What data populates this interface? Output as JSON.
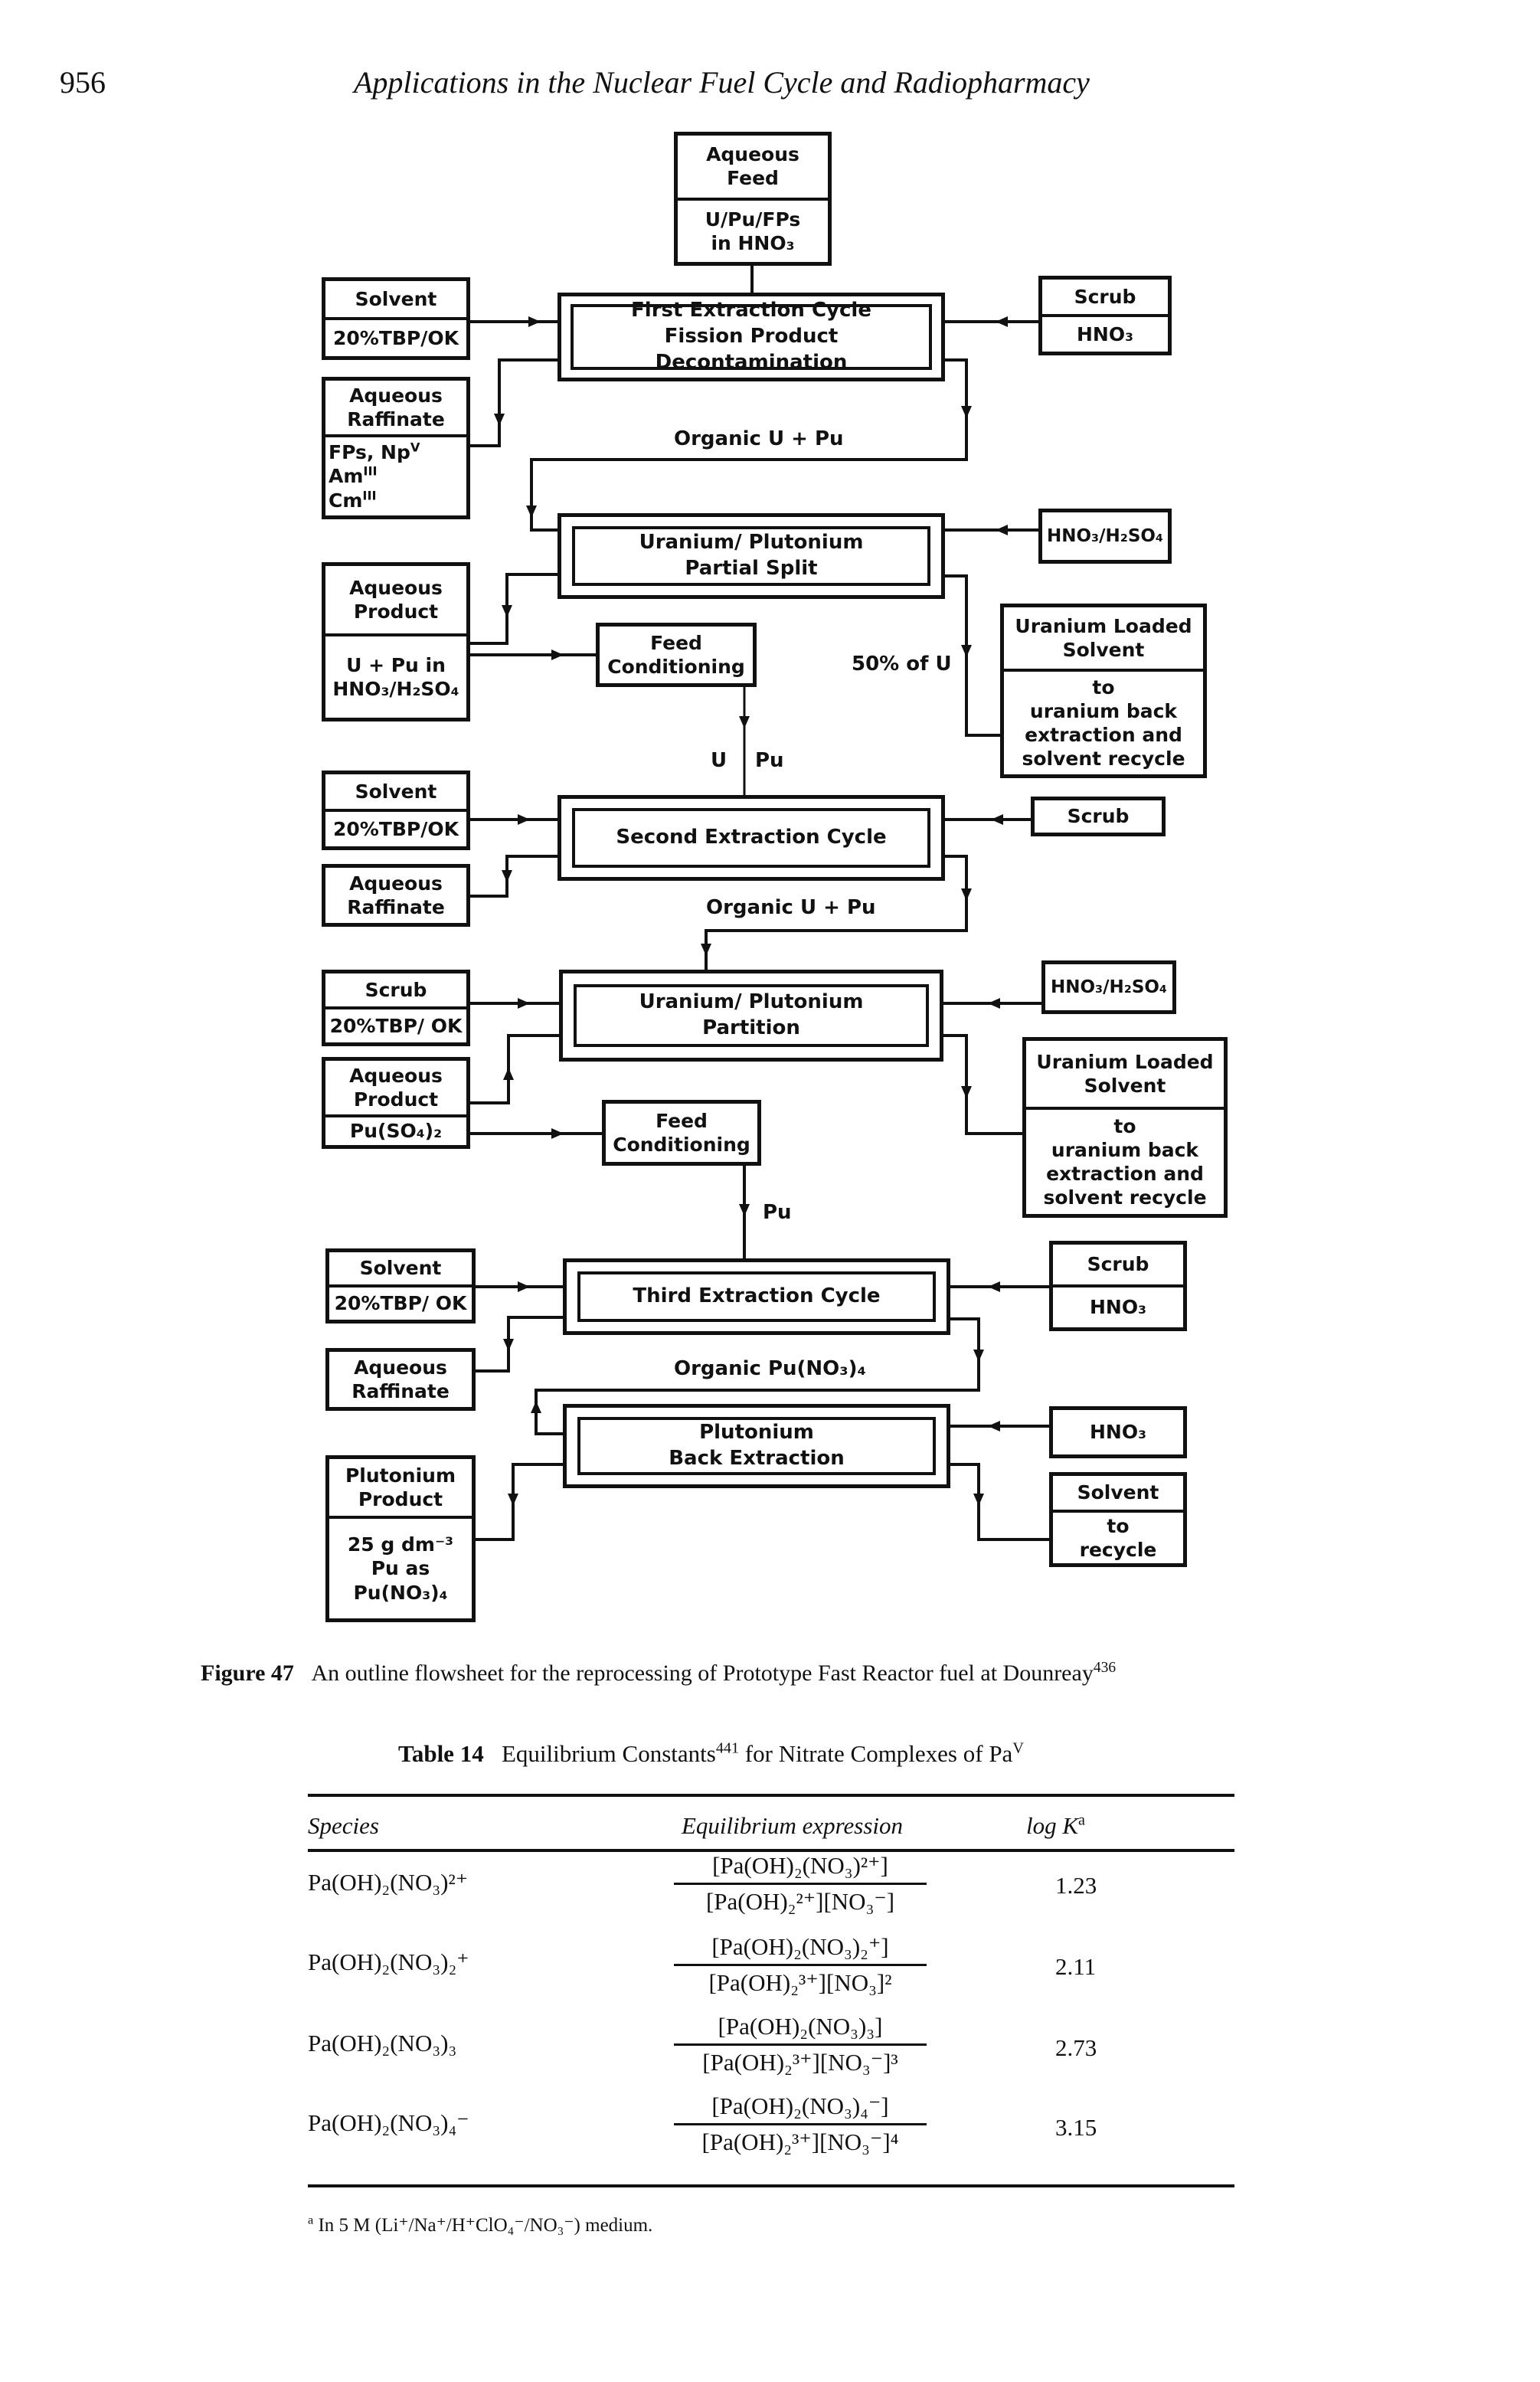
{
  "header": {
    "page_number": "956",
    "running_title": "Applications in the Nuclear Fuel Cycle and Radiopharmacy"
  },
  "flowsheet": {
    "aqueous_feed": {
      "title": [
        "Aqueous",
        "Feed"
      ],
      "content": [
        "U/Pu/FPs",
        "in HNO₃"
      ]
    },
    "cycle1": {
      "process": [
        "First Extraction Cycle",
        "Fission Product Decontamination"
      ],
      "solvent": {
        "title": "Solvent",
        "content": "20%TBP/OK"
      },
      "scrub": {
        "title": "Scrub",
        "content": "HNO₃"
      },
      "raffinate": {
        "title": [
          "Aqueous",
          "Raffinate"
        ],
        "content": [
          "FPs, Np",
          "Am",
          "Cm"
        ],
        "superscripts": [
          "V",
          "III",
          "III"
        ]
      },
      "organic_label": "Organic U + Pu"
    },
    "split": {
      "process": [
        "Uranium/ Plutonium",
        "Partial Split"
      ],
      "reagent": "HNO₃/H₂SO₄",
      "product": {
        "title": [
          "Aqueous",
          "Product"
        ],
        "content": [
          "U + Pu in",
          "HNO₃/H₂SO₄"
        ]
      },
      "feed_conditioning": [
        "Feed",
        "Conditioning"
      ],
      "fraction_label": "50% of U",
      "uranium_solvent": {
        "title": [
          "Uranium Loaded",
          "Solvent"
        ],
        "content": [
          "to",
          "uranium back",
          "extraction and",
          "solvent recycle"
        ]
      },
      "stream_left": "U",
      "stream_right": "Pu"
    },
    "cycle2": {
      "process": [
        "Second Extraction Cycle"
      ],
      "solvent": {
        "title": "Solvent",
        "content": "20%TBP/OK"
      },
      "scrub": {
        "title": "Scrub"
      },
      "raffinate": {
        "title": [
          "Aqueous",
          "Raffinate"
        ]
      },
      "organic_label": "Organic U + Pu"
    },
    "partition": {
      "process": [
        "Uranium/ Plutonium",
        "Partition"
      ],
      "scrub": {
        "title": "Scrub",
        "content": "20%TBP/ OK"
      },
      "reagent": "HNO₃/H₂SO₄",
      "product": {
        "title": [
          "Aqueous",
          "Product"
        ],
        "content": "Pu(SO₄)₂"
      },
      "feed_conditioning": [
        "Feed",
        "Conditioning"
      ],
      "uranium_solvent": {
        "title": [
          "Uranium Loaded",
          "Solvent"
        ],
        "content": [
          "to",
          "uranium back",
          "extraction and",
          "solvent recycle"
        ]
      },
      "stream": "Pu"
    },
    "cycle3": {
      "process": [
        "Third Extraction Cycle"
      ],
      "solvent": {
        "title": "Solvent",
        "content": "20%TBP/ OK"
      },
      "scrub": {
        "title": "Scrub",
        "content": "HNO₃"
      },
      "raffinate": {
        "title": [
          "Aqueous",
          "Raffinate"
        ]
      },
      "organic_label": "Organic Pu(NO₃)₄"
    },
    "back_extraction": {
      "process": [
        "Plutonium",
        "Back Extraction"
      ],
      "reagent": "HNO₃",
      "solvent": {
        "title": "Solvent",
        "content": [
          "to",
          "recycle"
        ]
      },
      "product": {
        "title": [
          "Plutonium",
          "Product"
        ],
        "content": [
          "25 g dm⁻³",
          "Pu as",
          "Pu(NO₃)₄"
        ]
      }
    }
  },
  "figure_caption": {
    "label": "Figure 47",
    "text": "An outline flowsheet for the reprocessing of Prototype Fast Reactor fuel at Dounreay",
    "ref": "436"
  },
  "table": {
    "label": "Table 14",
    "title": "Equilibrium Constants",
    "title_ref": "441",
    "title_rest": " for Nitrate Complexes of Pa",
    "title_sup": "V",
    "headers": [
      "Species",
      "Equilibrium expression",
      "log K"
    ],
    "header_note": "a",
    "rows": [
      {
        "species": "Pa(OH)₂(NO₃)²⁺",
        "numerator": "[Pa(OH)₂(NO₃)²⁺]",
        "denominator": "[Pa(OH)₂²⁺][NO₃⁻]",
        "logK": "1.23"
      },
      {
        "species": "Pa(OH)₂(NO₃)₂⁺",
        "numerator": "[Pa(OH)₂(NO₃)₂⁺]",
        "denominator": "[Pa(OH)₂³⁺][NO₃]²",
        "logK": "2.11"
      },
      {
        "species": "Pa(OH)₂(NO₃)₃",
        "numerator": "[Pa(OH)₂(NO₃)₃]",
        "denominator": "[Pa(OH)₂³⁺][NO₃⁻]³",
        "logK": "2.73"
      },
      {
        "species": "Pa(OH)₂(NO₃)₄⁻",
        "numerator": "[Pa(OH)₂(NO₃)₄⁻]",
        "denominator": "[Pa(OH)₂³⁺][NO₃⁻]⁴",
        "logK": "3.15"
      }
    ],
    "footnote_mark": "a",
    "footnote": "In 5 M (Li⁺/Na⁺/H⁺ClO₄⁻/NO₃⁻) medium."
  }
}
